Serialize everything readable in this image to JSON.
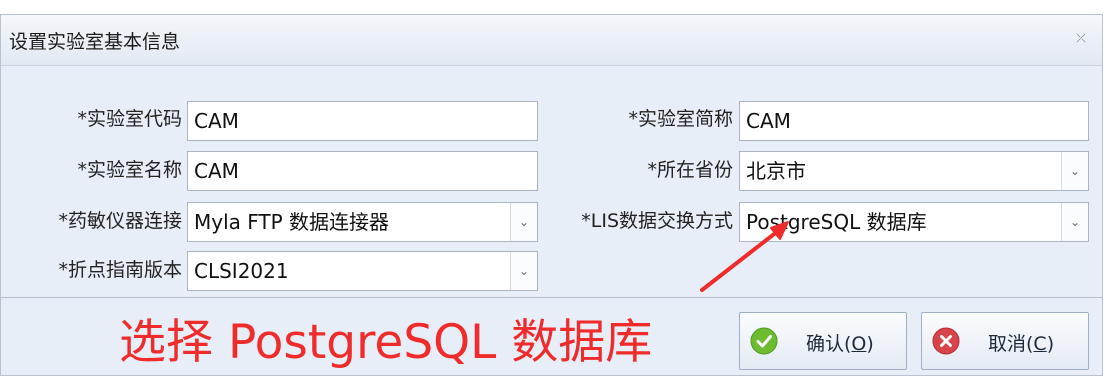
{
  "dialog": {
    "title": "设置实验室基本信息",
    "close_glyph": "⤫"
  },
  "form": {
    "lab_code": {
      "label": "*实验室代码",
      "value": "CAM"
    },
    "lab_short": {
      "label": "*实验室简称",
      "value": "CAM"
    },
    "lab_name": {
      "label": "*实验室名称",
      "value": "CAM"
    },
    "province": {
      "label": "*所在省份",
      "value": "北京市"
    },
    "instrument": {
      "label": "*药敏仪器连接",
      "value": "Myla FTP 数据连接器"
    },
    "lis_mode": {
      "label": "*LIS数据交换方式",
      "value": "PostgreSQL 数据库"
    },
    "breakpoint": {
      "label": "*折点指南版本",
      "value": "CLSI2021"
    }
  },
  "buttons": {
    "ok": {
      "label_pre": "确认(",
      "mnemonic": "O",
      "label_post": ")"
    },
    "cancel": {
      "label_pre": "取消(",
      "mnemonic": "C",
      "label_post": ")"
    }
  },
  "annotation": {
    "text": "选择 PostgreSQL 数据库",
    "color": "#ef2b2b"
  },
  "colors": {
    "ok_icon": "#6dbb2f",
    "cancel_icon": "#d9434a"
  }
}
